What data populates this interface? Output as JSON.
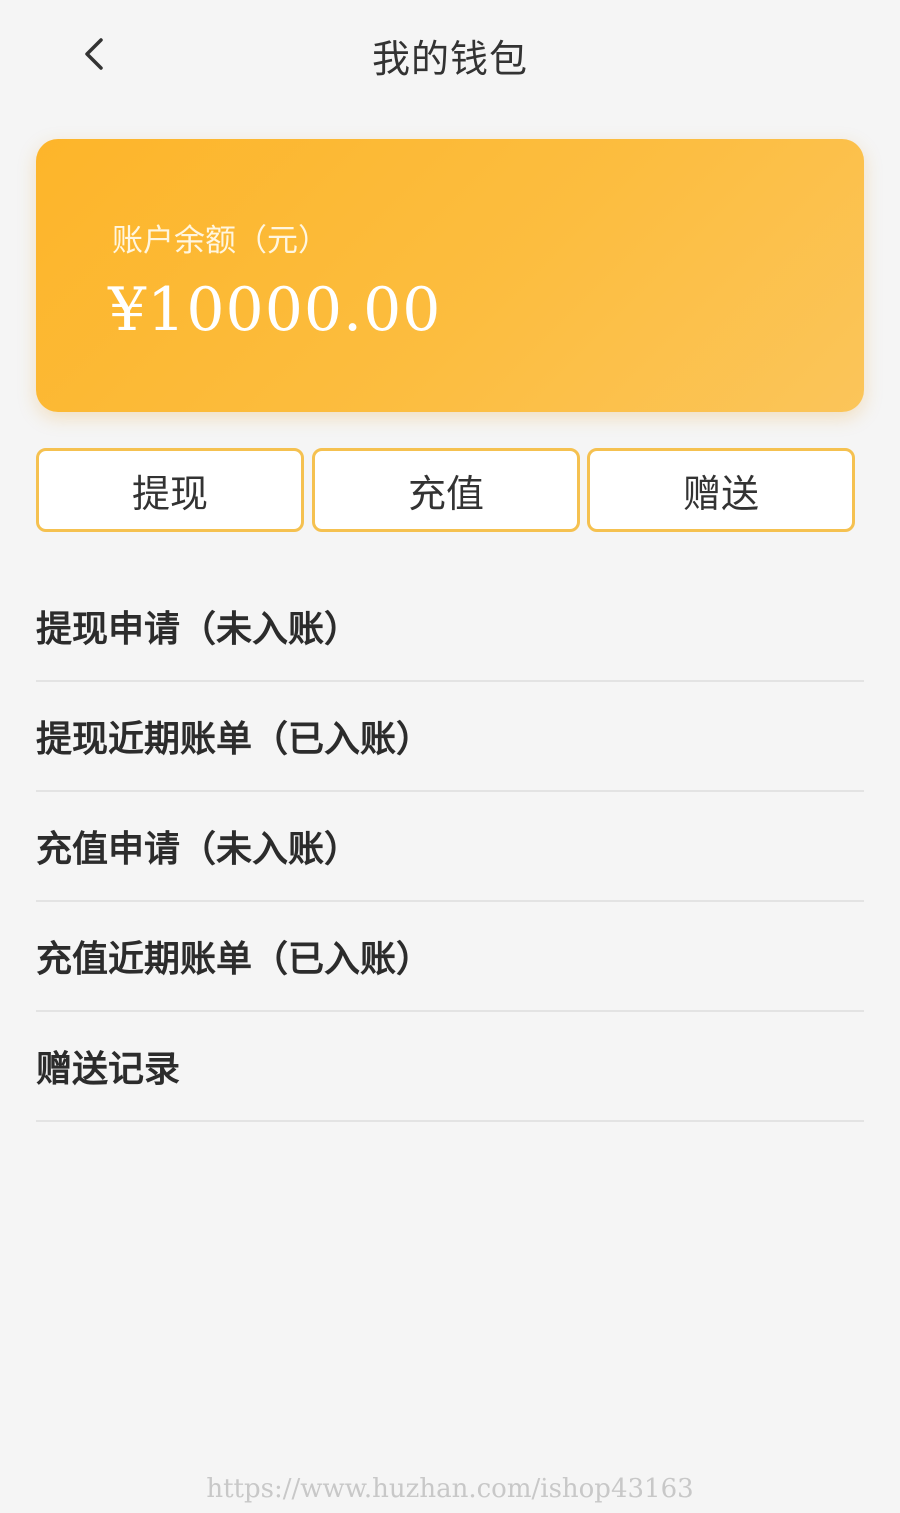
{
  "header": {
    "title": "我的钱包",
    "back_icon": "chevron-left-icon"
  },
  "balance_card": {
    "label": "账户余额（元）",
    "amount": "¥10000.00",
    "gradient_start": "#fdb52a",
    "gradient_end": "#fbc55a"
  },
  "actions": {
    "withdraw": "提现",
    "recharge": "充值",
    "gift": "赠送",
    "border_color": "#f5c150"
  },
  "menu": {
    "items": [
      {
        "label": "提现申请（未入账）"
      },
      {
        "label": "提现近期账单（已入账）"
      },
      {
        "label": "充值申请（未入账）"
      },
      {
        "label": "充值近期账单（已入账）"
      },
      {
        "label": "赠送记录"
      }
    ]
  },
  "watermark": "https://www.huzhan.com/ishop43163"
}
